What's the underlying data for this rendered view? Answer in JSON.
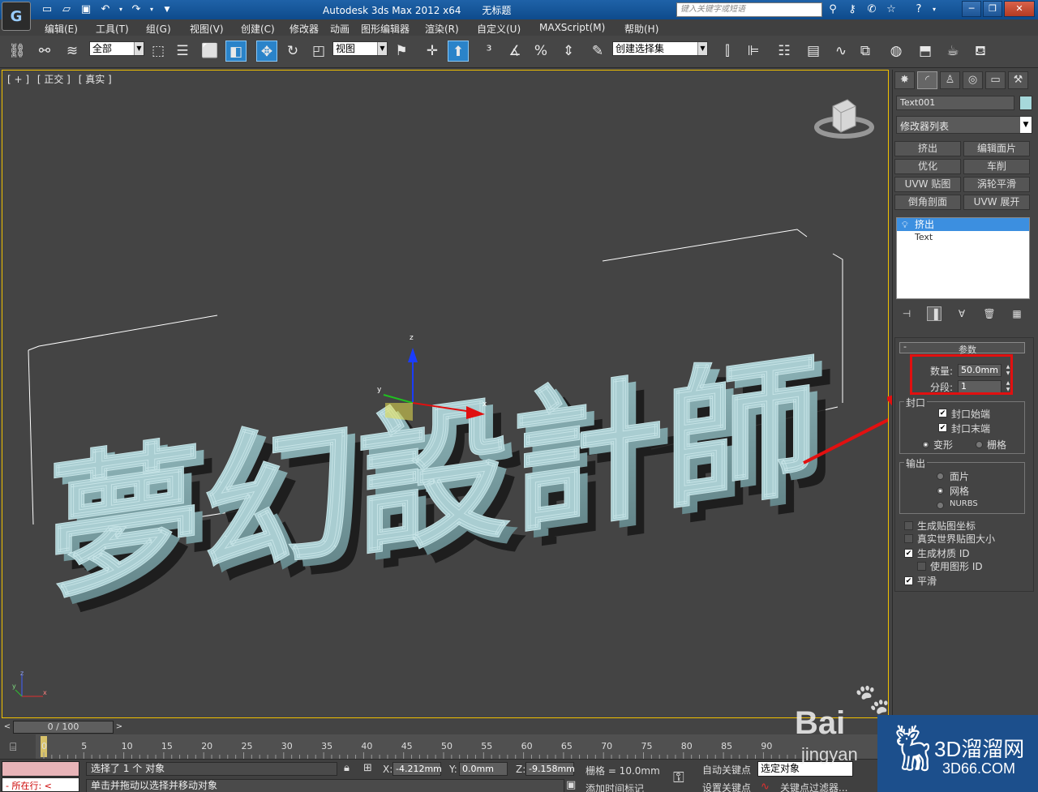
{
  "title": {
    "app_name": "Autodesk 3ds Max  2012 x64",
    "file_name": "无标题",
    "search_placeholder": "键入关键字或短语"
  },
  "menu": [
    "编辑(E)",
    "工具(T)",
    "组(G)",
    "视图(V)",
    "创建(C)",
    "修改器",
    "动画",
    "图形编辑器",
    "渲染(R)",
    "自定义(U)",
    "MAXScript(M)",
    "帮助(H)"
  ],
  "toolbar": {
    "selection_filter": "全部",
    "ref_coord": "视图",
    "named_selection": "创建选择集"
  },
  "viewport": {
    "label_parts": [
      "[ + ]",
      "[ 正交 ]",
      "[ 真实 ]"
    ],
    "scene_text": "夢幻設計師",
    "object_color": "#a6d8db"
  },
  "panel": {
    "object_name": "Text001",
    "modifier_list": "修改器列表",
    "modifier_buttons": [
      "挤出",
      "编辑面片",
      "优化",
      "车削",
      "UVW 贴图",
      "涡轮平滑",
      "倒角剖面",
      "UVW 展开"
    ],
    "stack": [
      {
        "label": "挤出",
        "selected": true
      },
      {
        "label": "Text",
        "selected": false
      }
    ],
    "rollout_title": "参数",
    "amount_label": "数量:",
    "amount_value": "50.0mm",
    "segments_label": "分段:",
    "segments_value": "1",
    "capping": {
      "title": "封口",
      "cap_start": "封口始端",
      "cap_end": "封口末端",
      "morph": "变形",
      "grid": "栅格"
    },
    "output": {
      "title": "输出",
      "patch": "面片",
      "mesh": "网格",
      "nurbs": "NURBS"
    },
    "options": {
      "gen_map_coords": "生成贴图坐标",
      "real_world_map": "真实世界贴图大小",
      "gen_mat_ids": "生成材质 ID",
      "use_shape_ids": "使用图形 ID",
      "smooth": "平滑"
    }
  },
  "timeline": {
    "frame_display": "0 / 100",
    "ticks": [
      "0",
      "5",
      "10",
      "15",
      "20",
      "25",
      "30",
      "35",
      "40",
      "45",
      "50",
      "55",
      "60",
      "65",
      "70",
      "75",
      "80",
      "85",
      "90"
    ]
  },
  "status": {
    "selection": "选择了 1 个 对象",
    "prompt": "单击并拖动以选择并移动对象",
    "maxscript_line": "-  所在行:  <",
    "x_value": "-4.212mm",
    "y_value": "0.0mm",
    "z_value": "-9.158mm",
    "grid": "栅格 = 10.0mm",
    "add_time_tag": "添加时间标记",
    "auto_key": "自动关键点",
    "set_key": "设置关键点",
    "selected_objects": "选定对象",
    "key_filters": "关键点过滤器..."
  },
  "watermarks": {
    "baidu": "Bai",
    "baidu_sub": "jingyan",
    "site_big": "3D溜溜网",
    "site_small": "3D66.COM"
  },
  "colors": {
    "title_bar": "#1f62a8",
    "highlight_red": "#e21010",
    "stack_select": "#3c8fe0",
    "viewport_border": "#f0c000"
  }
}
